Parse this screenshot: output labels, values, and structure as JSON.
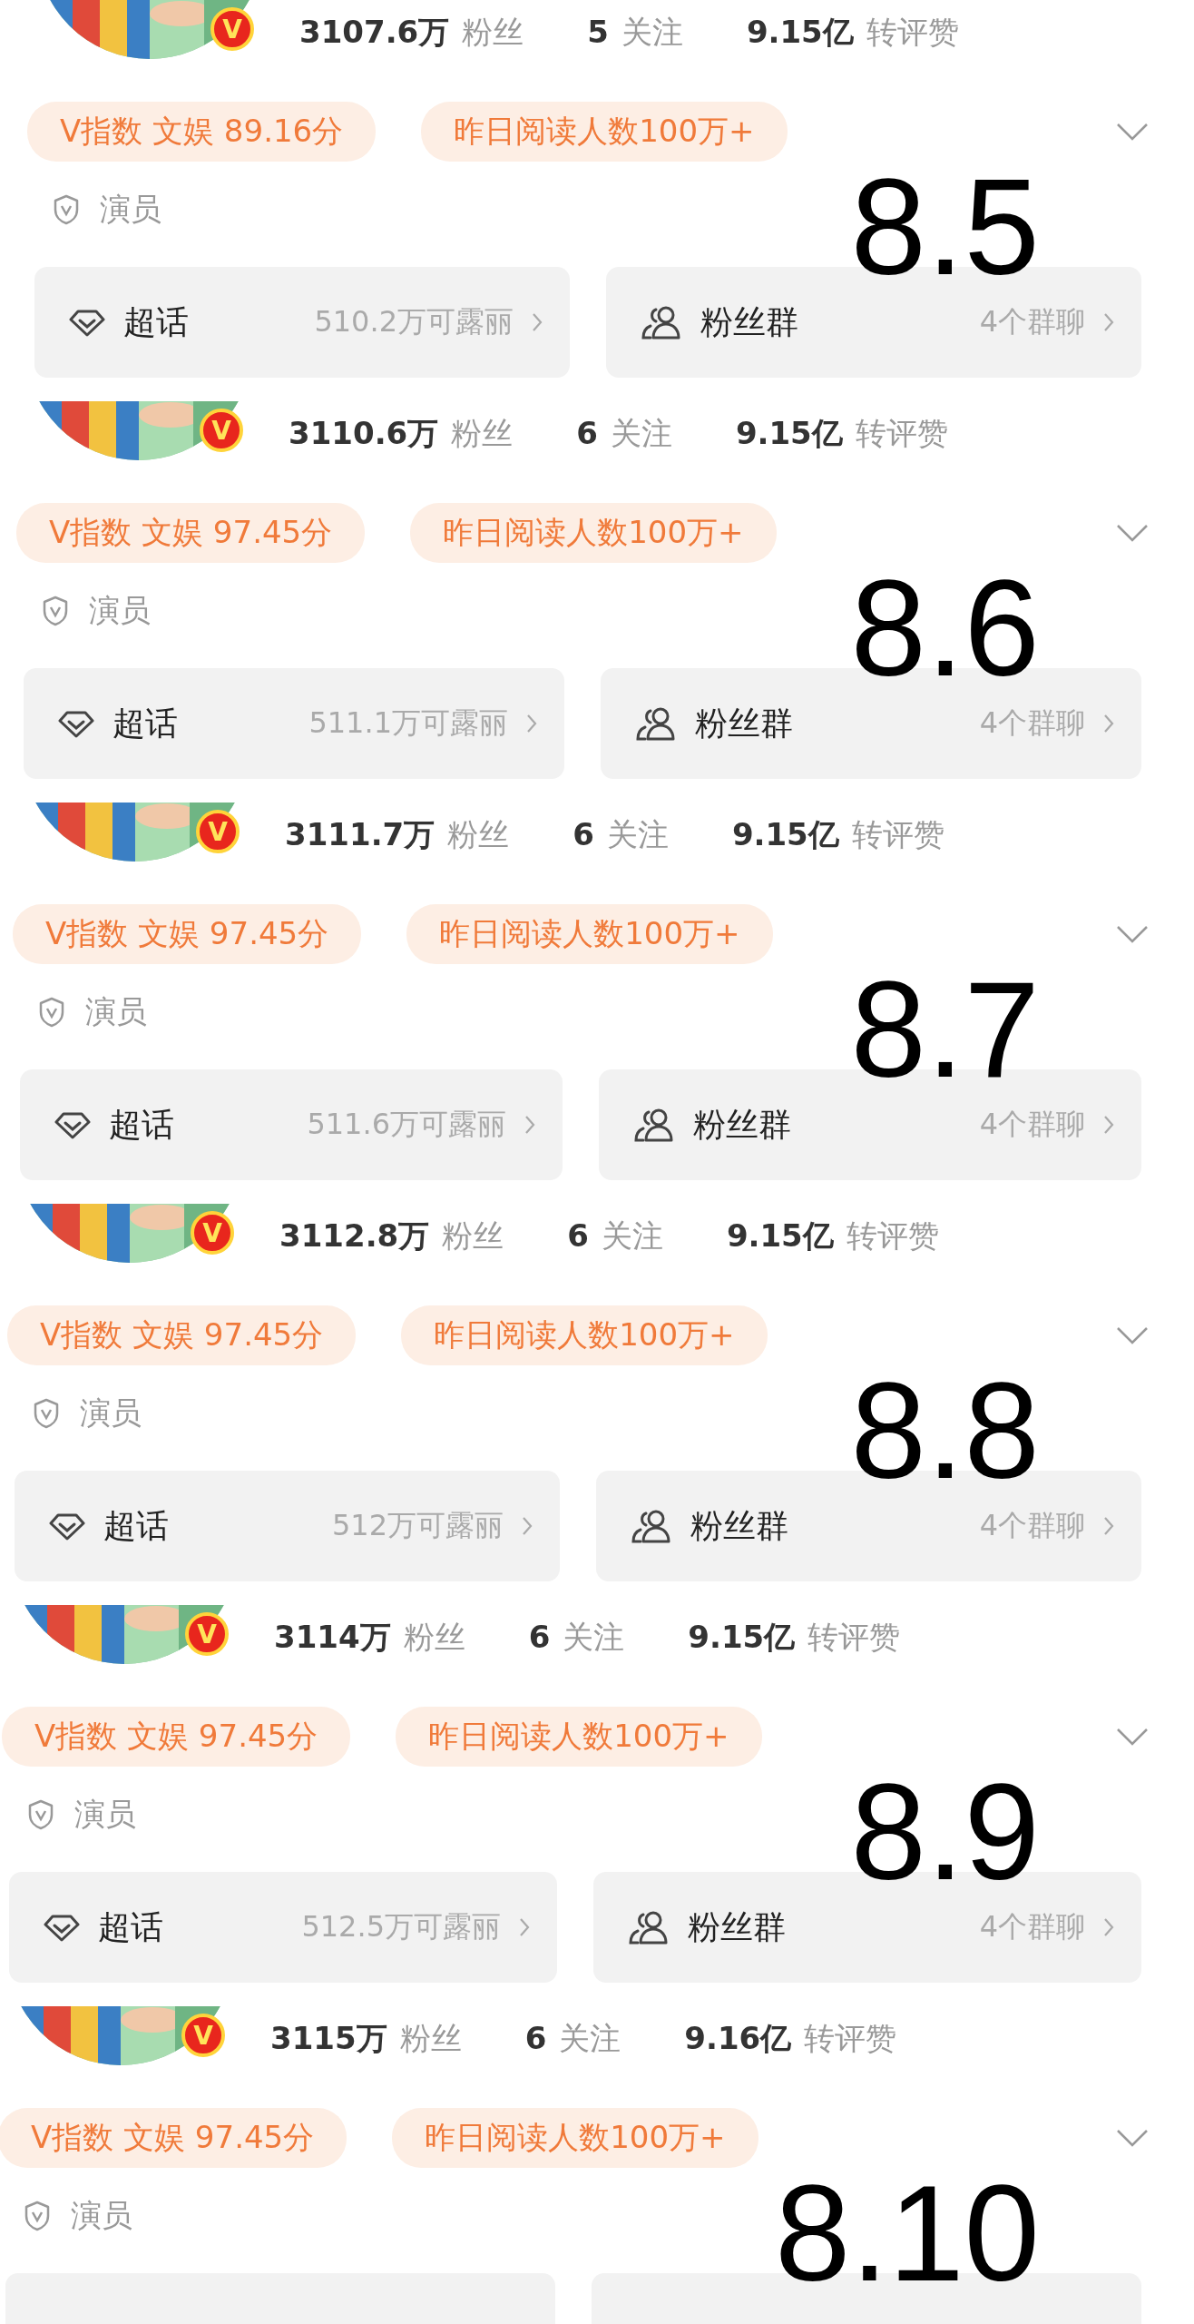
{
  "segments": [
    {
      "badge": "V",
      "stats": [
        {
          "value": "3107.6万",
          "label": "粉丝"
        },
        {
          "value": "5",
          "label": "关注"
        },
        {
          "value": "9.15亿",
          "label": "转评赞"
        }
      ],
      "tags": [
        "V指数 文娱 89.16分",
        "昨日阅读人数100万+"
      ],
      "role": "演员",
      "date": "8.5",
      "cards": [
        {
          "kind": "topic",
          "title": "超话",
          "info": "510.2万可露丽"
        },
        {
          "kind": "fans",
          "title": "粉丝群",
          "info": "4个群聊"
        }
      ]
    },
    {
      "badge": "V",
      "stats": [
        {
          "value": "3110.6万",
          "label": "粉丝"
        },
        {
          "value": "6",
          "label": "关注"
        },
        {
          "value": "9.15亿",
          "label": "转评赞"
        }
      ],
      "tags": [
        "V指数 文娱 97.45分",
        "昨日阅读人数100万+"
      ],
      "role": "演员",
      "date": "8.6",
      "cards": [
        {
          "kind": "topic",
          "title": "超话",
          "info": "511.1万可露丽"
        },
        {
          "kind": "fans",
          "title": "粉丝群",
          "info": "4个群聊"
        }
      ]
    },
    {
      "badge": "V",
      "stats": [
        {
          "value": "3111.7万",
          "label": "粉丝"
        },
        {
          "value": "6",
          "label": "关注"
        },
        {
          "value": "9.15亿",
          "label": "转评赞"
        }
      ],
      "tags": [
        "V指数 文娱 97.45分",
        "昨日阅读人数100万+"
      ],
      "role": "演员",
      "date": "8.7",
      "cards": [
        {
          "kind": "topic",
          "title": "超话",
          "info": "511.6万可露丽"
        },
        {
          "kind": "fans",
          "title": "粉丝群",
          "info": "4个群聊"
        }
      ]
    },
    {
      "badge": "V",
      "stats": [
        {
          "value": "3112.8万",
          "label": "粉丝"
        },
        {
          "value": "6",
          "label": "关注"
        },
        {
          "value": "9.15亿",
          "label": "转评赞"
        }
      ],
      "tags": [
        "V指数 文娱 97.45分",
        "昨日阅读人数100万+"
      ],
      "role": "演员",
      "date": "8.8",
      "cards": [
        {
          "kind": "topic",
          "title": "超话",
          "info": "512万可露丽"
        },
        {
          "kind": "fans",
          "title": "粉丝群",
          "info": "4个群聊"
        }
      ]
    },
    {
      "badge": "V",
      "stats": [
        {
          "value": "3114万",
          "label": "粉丝"
        },
        {
          "value": "6",
          "label": "关注"
        },
        {
          "value": "9.15亿",
          "label": "转评赞"
        }
      ],
      "tags": [
        "V指数 文娱 97.45分",
        "昨日阅读人数100万+"
      ],
      "role": "演员",
      "date": "8.9",
      "cards": [
        {
          "kind": "topic",
          "title": "超话",
          "info": "512.5万可露丽"
        },
        {
          "kind": "fans",
          "title": "粉丝群",
          "info": "4个群聊"
        }
      ]
    },
    {
      "badge": "V",
      "stats": [
        {
          "value": "3115万",
          "label": "粉丝"
        },
        {
          "value": "6",
          "label": "关注"
        },
        {
          "value": "9.16亿",
          "label": "转评赞"
        }
      ],
      "tags": [
        "V指数 文娱 97.45分",
        "昨日阅读人数100万+"
      ],
      "role": "演员",
      "date": "8.10",
      "cards": [
        {
          "kind": "topic"
        },
        {
          "kind": "fans"
        }
      ]
    }
  ]
}
